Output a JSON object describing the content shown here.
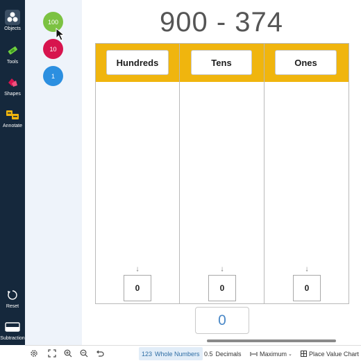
{
  "nav": {
    "items": [
      {
        "label": "Objects",
        "icon": "objects-icon",
        "active": true
      },
      {
        "label": "Tools",
        "icon": "tools-icon"
      },
      {
        "label": "Shapes",
        "icon": "shapes-icon"
      },
      {
        "label": "Annotate",
        "icon": "annotate-icon"
      },
      {
        "label": "Reset",
        "icon": "reset-icon"
      },
      {
        "label": "Subtraction",
        "icon": "subtraction-icon"
      }
    ]
  },
  "palette": {
    "disks": [
      {
        "label": "100",
        "color": "#7cc242"
      },
      {
        "label": "10",
        "color": "#d7144e"
      },
      {
        "label": "1",
        "color": "#2c8fe0"
      }
    ]
  },
  "problem": {
    "expression": "900 - 374"
  },
  "chart": {
    "header_color": "#f0b50e",
    "columns": [
      {
        "label": "Hundreds",
        "count": "0"
      },
      {
        "label": "Tens",
        "count": "0"
      },
      {
        "label": "Ones",
        "count": "0"
      }
    ],
    "total": "0"
  },
  "toolbar": {
    "whole_numbers": {
      "code": "123",
      "label": "Whole Numbers"
    },
    "decimals": {
      "code": "0.5",
      "label": "Decimals"
    },
    "maximum_label": "Maximum",
    "view_label": "Place Value Chart"
  }
}
